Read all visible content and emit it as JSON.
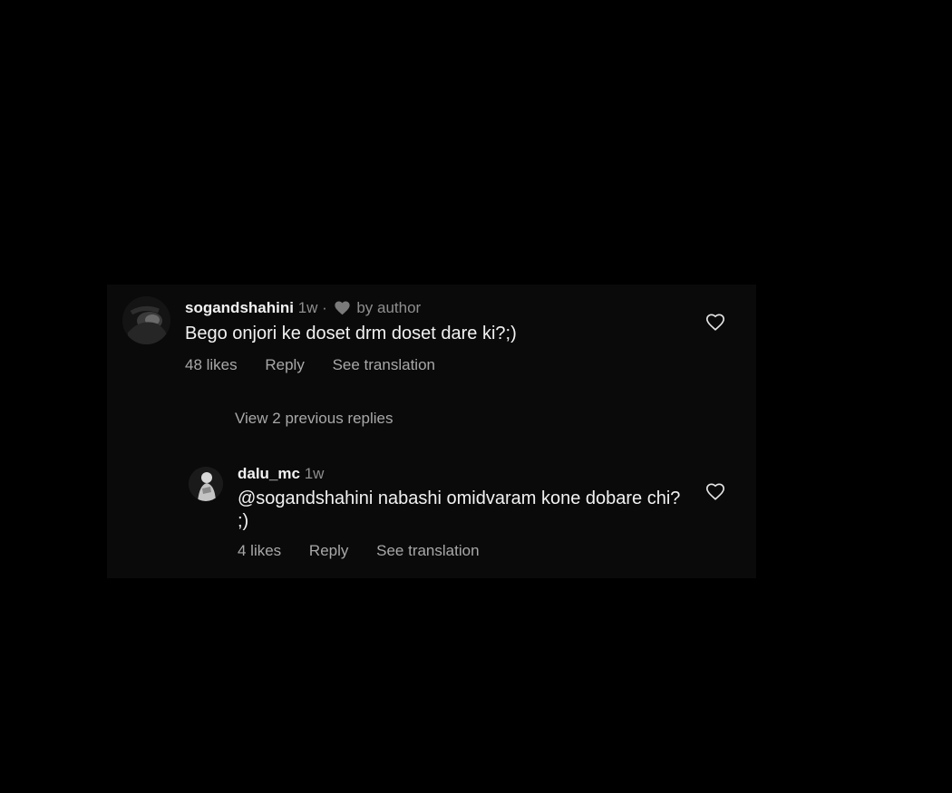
{
  "comment": {
    "username": "sogandshahini",
    "time": "1w",
    "separator": "·",
    "liked_by": "by author",
    "text": "Bego onjori ke doset drm doset dare ki?;)",
    "likes": "48 likes",
    "reply_label": "Reply",
    "translate_label": "See translation"
  },
  "view_previous": "View 2 previous replies",
  "reply": {
    "username": "dalu_mc",
    "time": "1w",
    "text": "@sogandshahini nabashi omidvaram kone dobare chi? ;)",
    "likes": "4 likes",
    "reply_label": "Reply",
    "translate_label": "See translation"
  },
  "colors": {
    "background": "#000000",
    "panel": "#0a0a0a",
    "text_primary": "#f2f2f2",
    "text_secondary": "#a8a8a8",
    "meta": "#8e8e8e"
  },
  "icons": {
    "like": "heart-outline-icon",
    "author_like": "heart-filled-icon"
  }
}
